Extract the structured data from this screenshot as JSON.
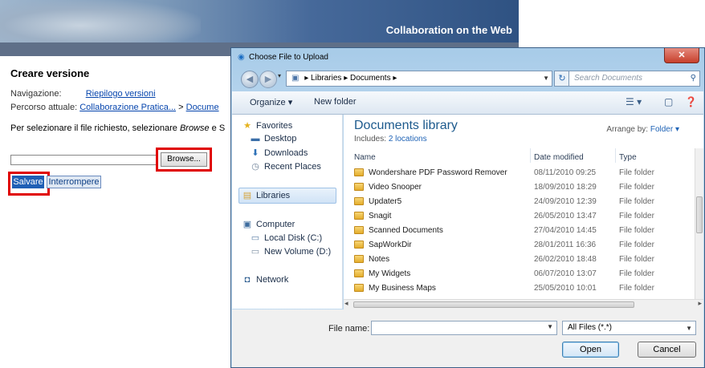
{
  "page": {
    "banner_title": "Collaboration on the Web",
    "heading": "Creare versione",
    "nav_label": "Navigazione:",
    "nav_link": "Riepilogo versioni",
    "path_label": "Percorso attuale:",
    "path_link1": "Collaborazione Pratica...",
    "path_sep": ">",
    "path_link2": "Docume",
    "instruction_prefix": "Per selezionare il file richiesto, selezionare ",
    "instruction_em": "Browse",
    "instruction_suffix": " e S",
    "browse_label": "Browse...",
    "save_label": "Salvare",
    "cancel_label": "Interrompere",
    "highlight_color": "#e00000"
  },
  "dialog": {
    "title": "Choose File to Upload",
    "address": {
      "items": [
        "Libraries",
        "Documents"
      ],
      "separator": "▸"
    },
    "search_placeholder": "Search Documents",
    "toolbar": {
      "organize": "Organize ▾",
      "new_folder": "New folder"
    },
    "nav_pane": {
      "favorites": "Favorites",
      "desktop": "Desktop",
      "downloads": "Downloads",
      "recent_places": "Recent Places",
      "libraries": "Libraries",
      "computer": "Computer",
      "local_disk": "Local Disk (C:)",
      "new_volume": "New Volume (D:)",
      "network": "Network"
    },
    "library": {
      "title": "Documents library",
      "includes_label": "Includes: ",
      "includes_link": "2 locations",
      "arrange_label": "Arrange by: ",
      "arrange_value": "Folder ▾"
    },
    "columns": {
      "name": "Name",
      "date": "Date modified",
      "type": "Type"
    },
    "files": [
      {
        "name": "Wondershare PDF Password Remover",
        "date": "08/11/2010 09:25",
        "type": "File folder"
      },
      {
        "name": "Video Snooper",
        "date": "18/09/2010 18:29",
        "type": "File folder"
      },
      {
        "name": "Updater5",
        "date": "24/09/2010 12:39",
        "type": "File folder"
      },
      {
        "name": "Snagit",
        "date": "26/05/2010 13:47",
        "type": "File folder"
      },
      {
        "name": "Scanned Documents",
        "date": "27/04/2010 14:45",
        "type": "File folder"
      },
      {
        "name": "SapWorkDir",
        "date": "28/01/2011 16:36",
        "type": "File folder"
      },
      {
        "name": "Notes",
        "date": "26/02/2010 18:48",
        "type": "File folder"
      },
      {
        "name": "My Widgets",
        "date": "06/07/2010 13:07",
        "type": "File folder"
      },
      {
        "name": "My Business Maps",
        "date": "25/05/2010 10:01",
        "type": "File folder"
      }
    ],
    "file_name_label": "File name:",
    "file_name_value": "",
    "file_type": "All Files (*.*)",
    "open_label": "Open",
    "cancel_label": "Cancel"
  }
}
